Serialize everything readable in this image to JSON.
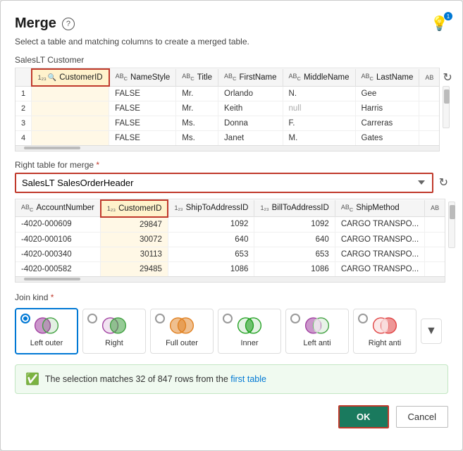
{
  "dialog": {
    "title": "Merge",
    "subtitle": "Select a table and matching columns to create a merged table.",
    "help_label": "?",
    "lightbulb_badge": "1"
  },
  "top_table": {
    "name": "SalesLT Customer",
    "columns": [
      "CustomerID",
      "NameStyle",
      "Title",
      "FirstName",
      "MiddleName",
      "LastName",
      ""
    ],
    "column_types": [
      "123-search",
      "ABC",
      "ABC",
      "ABC",
      "ABC",
      "ABC",
      "ABC"
    ],
    "rows": [
      {
        "num": "1",
        "CustomerID": "",
        "NameStyle": "FALSE",
        "Title": "Mr.",
        "FirstName": "Orlando",
        "MiddleName": "N.",
        "LastName": "Gee"
      },
      {
        "num": "2",
        "CustomerID": "",
        "NameStyle": "FALSE",
        "Title": "Mr.",
        "FirstName": "Keith",
        "MiddleName": "null",
        "LastName": "Harris"
      },
      {
        "num": "3",
        "CustomerID": "",
        "NameStyle": "FALSE",
        "Title": "Ms.",
        "FirstName": "Donna",
        "MiddleName": "F.",
        "LastName": "Carreras"
      },
      {
        "num": "4",
        "CustomerID": "",
        "NameStyle": "FALSE",
        "Title": "Ms.",
        "FirstName": "Janet",
        "MiddleName": "M.",
        "LastName": "Gates"
      }
    ]
  },
  "right_table": {
    "label": "Right table for merge",
    "required": true,
    "selected": "SalesLT SalesOrderHeader",
    "options": [
      "SalesLT SalesOrderHeader"
    ],
    "columns": [
      "AccountNumber",
      "CustomerID",
      "ShipToAddressID",
      "BillToAddressID",
      "ShipMethod",
      ""
    ],
    "column_types": [
      "ABC",
      "123",
      "123",
      "123",
      "ABC",
      "ABC"
    ],
    "rows": [
      {
        "AccountNumber": "-4020-000609",
        "CustomerID": "29847",
        "ShipToAddressID": "1092",
        "BillToAddressID": "1092",
        "ShipMethod": "CARGO TRANSPO..."
      },
      {
        "AccountNumber": "-4020-000106",
        "CustomerID": "30072",
        "ShipToAddressID": "640",
        "BillToAddressID": "640",
        "ShipMethod": "CARGO TRANSPO..."
      },
      {
        "AccountNumber": "-4020-000340",
        "CustomerID": "30113",
        "ShipToAddressID": "653",
        "BillToAddressID": "653",
        "ShipMethod": "CARGO TRANSPO..."
      },
      {
        "AccountNumber": "-4020-000582",
        "CustomerID": "29485",
        "ShipToAddressID": "1086",
        "BillToAddressID": "1086",
        "ShipMethod": "CARGO TRANSPO..."
      }
    ]
  },
  "join": {
    "label": "Join kind",
    "required": true,
    "options": [
      {
        "id": "left-outer",
        "name": "Left outer",
        "selected": true
      },
      {
        "id": "right",
        "name": "Right",
        "selected": false
      },
      {
        "id": "full-outer",
        "name": "Full outer",
        "selected": false
      },
      {
        "id": "inner",
        "name": "Inner",
        "selected": false
      },
      {
        "id": "left-anti",
        "name": "Left anti",
        "selected": false
      },
      {
        "id": "right-anti",
        "name": "Right anti",
        "selected": false
      }
    ]
  },
  "status": {
    "message_prefix": "The selection matches 32 of 847 rows from the ",
    "highlight": "first table",
    "message_suffix": ""
  },
  "footer": {
    "ok_label": "OK",
    "cancel_label": "Cancel"
  }
}
